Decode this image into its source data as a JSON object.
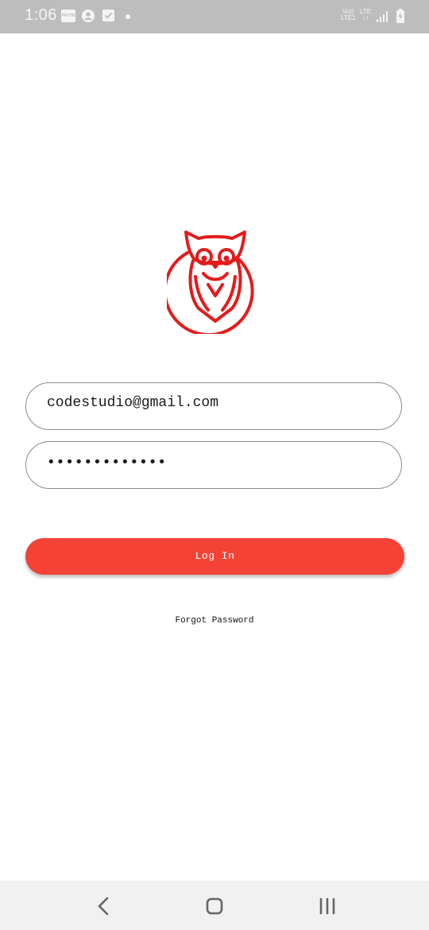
{
  "status_bar": {
    "time": "1:06",
    "icons": [
      "paytm-icon",
      "account-circle-icon",
      "task-check-icon",
      "dot-icon",
      "volte-icon",
      "lte-icon",
      "signal-icon",
      "battery-charging-icon"
    ],
    "paytm_label": "PAYTM",
    "volte_top": "Vo))",
    "volte_bottom": "LTE1",
    "lte_label": "LTE"
  },
  "logo": {
    "icon": "owl-logo-icon",
    "color": "#e41b1b"
  },
  "form": {
    "email_value": "codestudio@gmail.com",
    "password_value": "•••••••••••••"
  },
  "login_button": {
    "label": "Log In",
    "color": "#f44336"
  },
  "forgot_password": {
    "label": "Forgot Password"
  },
  "nav_bar": {
    "icons": [
      "back-icon",
      "home-icon",
      "recent-apps-icon"
    ]
  }
}
